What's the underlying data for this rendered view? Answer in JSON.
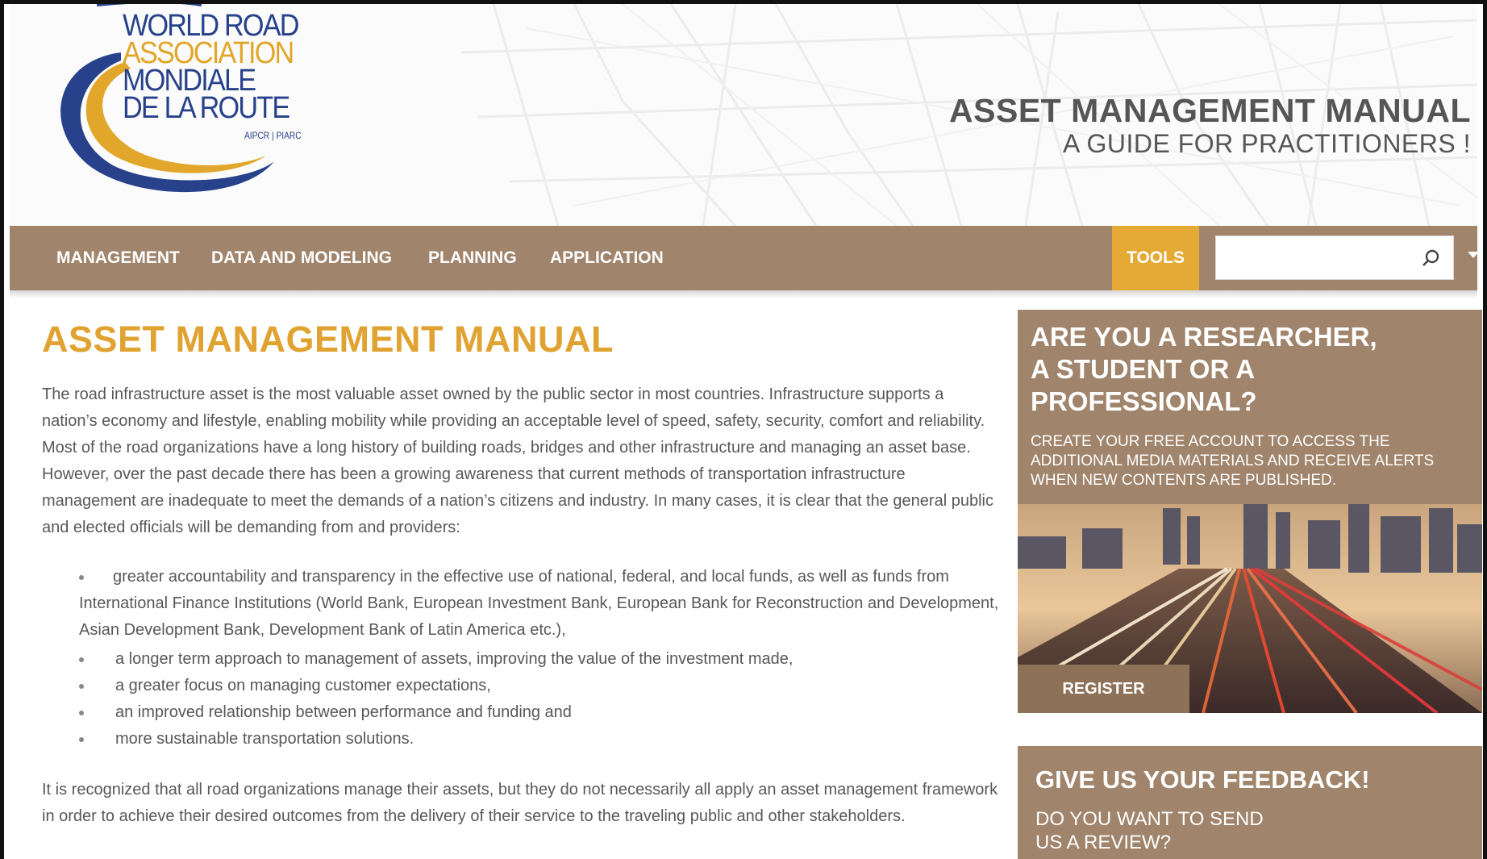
{
  "header": {
    "logo": {
      "line1": "WORLD ROAD",
      "line2": "ASSOCIATION",
      "line3": "MONDIALE",
      "line4": "DE LA ROUTE",
      "sub": "AIPCR | PIARC"
    },
    "title": "ASSET MANAGEMENT MANUAL",
    "subtitle": "A GUIDE FOR PRACTITIONERS !"
  },
  "nav": {
    "items": [
      "MANAGEMENT",
      "DATA AND MODELING",
      "PLANNING",
      "APPLICATION"
    ],
    "tools": "TOOLS",
    "search_placeholder": ""
  },
  "main": {
    "heading": "ASSET MANAGEMENT MANUAL",
    "intro": "The road infrastructure asset is the most valuable asset owned by the public sector in most countries. Infrastructure supports a nation’s economy and lifestyle, enabling mobility while providing an acceptable level of speed, safety, security, comfort and reliability. Most of the road organizations have a long history of building roads, bridges and other infrastructure and managing an asset base. However, over the past decade there has been a growing awareness that current methods of transportation infrastructure management are inadequate to meet the demands of a nation’s citizens and industry. In many cases, it is clear that the general public and elected officials will be demanding from and providers:",
    "bullets": [
      "greater accountability and transparency in the effective use of national, federal, and local funds, as well as funds from International Finance Institutions (World Bank, European Investment Bank, European Bank for Reconstruction and Development, Asian Development Bank, Development Bank of Latin America etc.),",
      "a longer term approach to management of assets, improving the value of the investment made,",
      "a greater focus on managing customer expectations,",
      "an improved relationship between performance and funding and",
      "more sustainable transportation solutions."
    ],
    "closing": "It is recognized that all road organizations manage their assets, but they do not necessarily all apply an asset management framework in order to achieve their desired outcomes from the delivery of their service to the traveling public and other stakeholders."
  },
  "sidebar": {
    "register_box": {
      "heading_l1": "ARE YOU A RESEARCHER,",
      "heading_l2": "A STUDENT OR A",
      "heading_l3": "PROFESSIONAL?",
      "text": "CREATE YOUR FREE ACCOUNT TO ACCESS THE ADDITIONAL MEDIA MATERIALS AND RECEIVE ALERTS WHEN NEW CONTENTS ARE PUBLISHED.",
      "button": "REGISTER"
    },
    "feedback_box": {
      "heading": "GIVE US YOUR FEEDBACK!",
      "text_l1": "DO YOU WANT TO SEND",
      "text_l2": "US A REVIEW?"
    }
  },
  "colors": {
    "brand_brown": "#a0846b",
    "accent_gold": "#e5a936",
    "logo_blue": "#27428a"
  }
}
